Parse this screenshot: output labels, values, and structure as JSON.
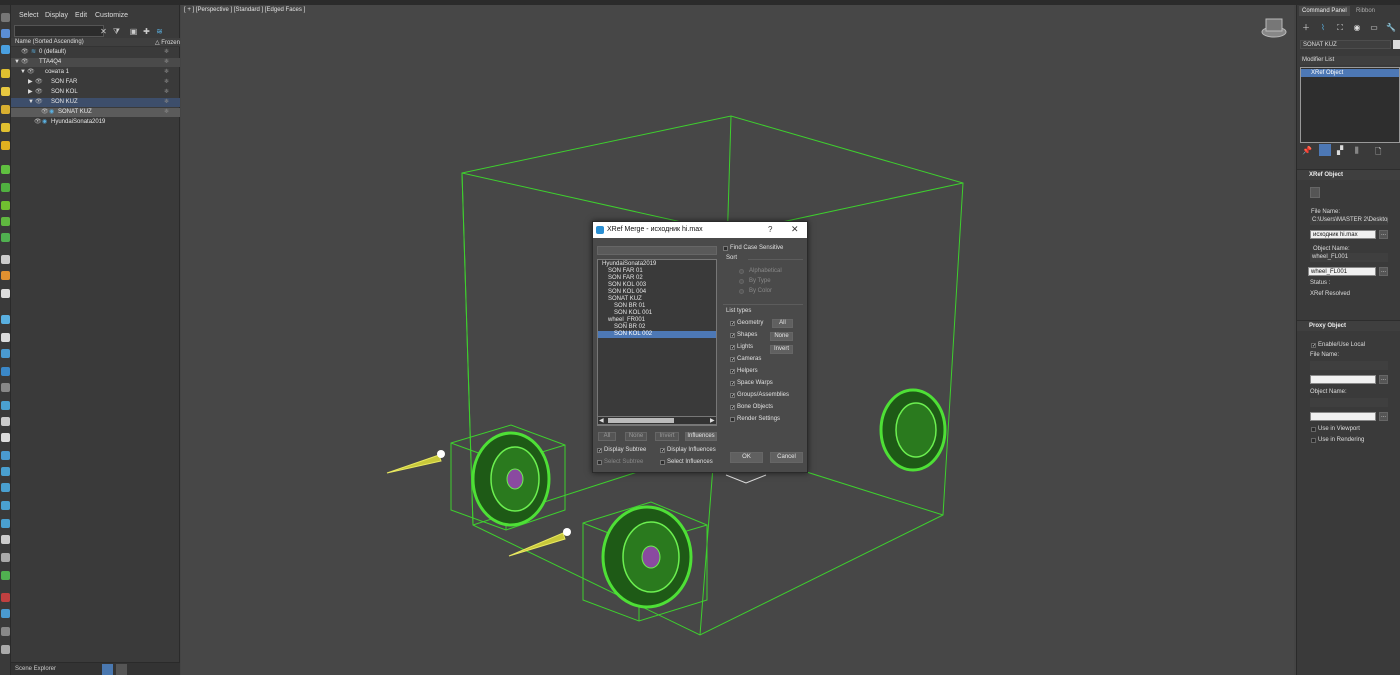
{
  "explorer": {
    "menu": [
      "Select",
      "Display",
      "Edit",
      "Customize"
    ],
    "header_name": "Name (Sorted Ascending)",
    "header_frozen": "△ Frozen",
    "rows": [
      {
        "label": "0 (default)"
      },
      {
        "label": "TTA4Q4"
      },
      {
        "label": "соната 1"
      },
      {
        "label": "SON FAR"
      },
      {
        "label": "SON KOL"
      },
      {
        "label": "SON KUZ"
      },
      {
        "label": "SONAT KUZ"
      },
      {
        "label": "HyundaiSonata2019"
      }
    ],
    "footer": "Scene Explorer"
  },
  "viewport": {
    "label": "[ + ] [Perspective ] [Standard ] [Edged Faces ]"
  },
  "right_panel": {
    "tabs": [
      "Command Panel",
      "Ribbon"
    ],
    "object_name": "SONAT KUZ",
    "modifier_list": "Modifier List",
    "stack_item": "XRef Object",
    "xref_section": "XRef Object",
    "file_name_label": "File Name:",
    "file_path": "C:\\Users\\MASTER 2\\Desktop",
    "file_name_value": "исходник hi.max",
    "object_name_label": "Object Name:",
    "object_name_value": "wheel_FL001",
    "object_name_field": "wheel_FL001",
    "status_label": "Status :",
    "status_value": "XRef Resolved",
    "proxy_section": "Proxy Object",
    "enable_local": "Enable/Use Local",
    "proxy_file_label": "File Name:",
    "proxy_object_label": "Object Name:",
    "use_viewport": "Use in Viewport",
    "use_rendering": "Use in Rendering",
    "dots": "..."
  },
  "dialog": {
    "title": "XRef Merge - исходник hi.max",
    "help": "?",
    "close": "✕",
    "list_items": [
      "HyundaiSonata2019",
      "SON FAR 01",
      "SON FAR 02",
      "SON KOL 003",
      "SON KOL 004",
      "SONAT KUZ",
      "SON BR 01",
      "SON KOL 001",
      "wheel_FR001",
      "SON BR 02",
      "SON KOL 002"
    ],
    "find_case": "Find Case Sensitive",
    "sort_label": "Sort",
    "sort_options": [
      "Alphabetical",
      "By Type",
      "By Color"
    ],
    "list_types_label": "List types",
    "types": [
      "Geometry",
      "Shapes",
      "Lights",
      "Cameras",
      "Helpers",
      "Space Warps",
      "Groups/Assemblies",
      "Bone Objects",
      "Render Settings"
    ],
    "type_buttons": [
      "All",
      "None",
      "Invert"
    ],
    "bottom_buttons": [
      "All",
      "None",
      "Invert",
      "Influences"
    ],
    "display_subtree": "Display Subtree",
    "display_influences": "Display Influences",
    "select_subtree": "Select Subtree",
    "select_influences": "Select Influences",
    "ok": "OK",
    "cancel": "Cancel"
  }
}
